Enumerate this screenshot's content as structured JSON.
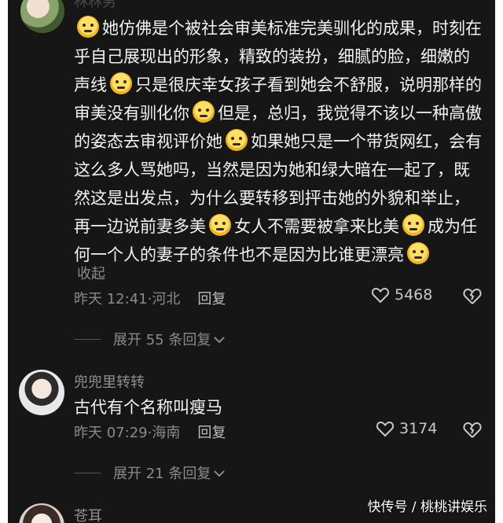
{
  "comment1": {
    "username": "林林男",
    "text_segments": [
      {
        "type": "emoji"
      },
      {
        "type": "text",
        "value": "她仿佛是个被社会审美标准完美驯化的成果，时刻在乎自己展现出的形象，精致的装扮，细腻的脸，细嫩的声线"
      },
      {
        "type": "emoji"
      },
      {
        "type": "text",
        "value": "只是很庆幸女孩子看到她会不舒服，说明那样的审美没有驯化你"
      },
      {
        "type": "emoji"
      },
      {
        "type": "text",
        "value": "但是，总归，我觉得不该以一种高傲的姿态去审视评价她"
      },
      {
        "type": "emoji"
      },
      {
        "type": "text",
        "value": "如果她只是一个带货网红，会有这么多人骂她吗，当然是因为她和绿大暗在一起了，既然这是出发点，为什么要转移到抨击她的外貌和举止，再一边说前妻多美"
      },
      {
        "type": "emoji"
      },
      {
        "type": "text",
        "value": "女人不需要被拿来比美"
      },
      {
        "type": "emoji"
      },
      {
        "type": "text",
        "value": "成为任何一个人的妻子的条件也不是因为比谁更漂亮"
      },
      {
        "type": "emoji"
      }
    ],
    "collapse_label": "收起",
    "time": "昨天 12:41",
    "location": "河北",
    "reply_label": "回复",
    "likes": "5468",
    "expand_label": "展开 55 条回复"
  },
  "comment2": {
    "username": "兜兜里转转",
    "text": "古代有个名称叫瘦马",
    "time": "昨天 07:29",
    "location": "海南",
    "reply_label": "回复",
    "likes": "3174",
    "expand_label": "展开 21 条回复"
  },
  "comment3": {
    "username": "苍耳"
  },
  "watermark": "快传号 / 桃桃讲娱乐",
  "colors": {
    "background": "#161616",
    "text": "#f2f2f2",
    "muted": "#8a8a8a"
  }
}
